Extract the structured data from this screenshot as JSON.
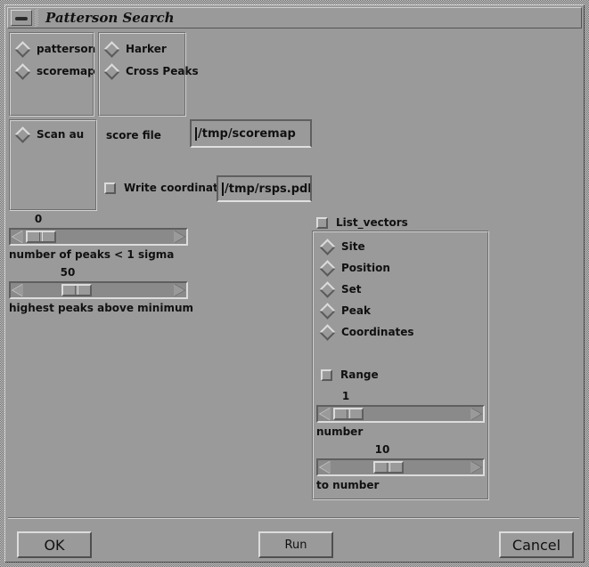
{
  "window": {
    "title": "Patterson Search",
    "menu_button_icon": "window-menu-icon"
  },
  "map_type_group": {
    "options": [
      {
        "label": "patterson",
        "selected": false
      },
      {
        "label": "scoremap",
        "selected": false
      }
    ]
  },
  "peak_type_group": {
    "options": [
      {
        "label": "Harker",
        "selected": false
      },
      {
        "label": "Cross Peaks",
        "selected": false
      }
    ]
  },
  "scan_group": {
    "options": [
      {
        "label": "Scan au",
        "selected": false
      }
    ]
  },
  "score_file": {
    "label": "score file",
    "value": "/tmp/scoremap"
  },
  "write_coordinates": {
    "label": "Write coordinates",
    "checked": false,
    "value": "/tmp/rsps.pdb"
  },
  "sliders": {
    "peaks_below_sigma": {
      "value": "0",
      "label": "number of peaks < 1 sigma",
      "thumb_fraction": 0.04
    },
    "highest_peaks": {
      "value": "50",
      "label": "highest peaks above minimum",
      "thumb_fraction": 0.3
    },
    "range_number": {
      "value": "1",
      "label": "number",
      "thumb_fraction": 0.05
    },
    "range_to_number": {
      "value": "10",
      "label": "to number",
      "thumb_fraction": 0.33
    }
  },
  "list_vectors": {
    "label": "List_vectors",
    "checked": false,
    "options": [
      {
        "label": "Site",
        "selected": false
      },
      {
        "label": "Position",
        "selected": false
      },
      {
        "label": "Set",
        "selected": false
      },
      {
        "label": "Peak",
        "selected": false
      },
      {
        "label": "Coordinates",
        "selected": false
      }
    ],
    "range": {
      "label": "Range",
      "checked": false
    }
  },
  "buttons": {
    "ok": "OK",
    "run": "Run",
    "cancel": "Cancel"
  },
  "colors": {
    "background": "#9a9a9a",
    "shadow": "#5f5f5f",
    "highlight": "#dcdcdc",
    "text": "#111111"
  }
}
